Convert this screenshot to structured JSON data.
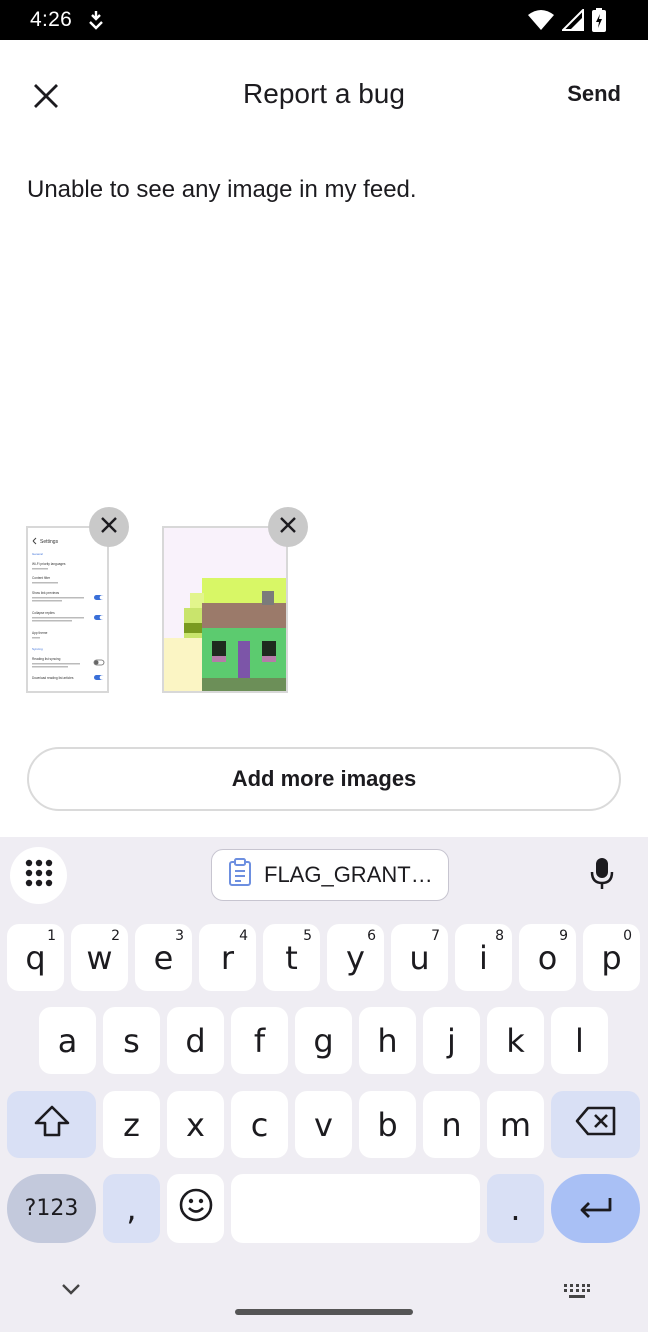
{
  "status_bar": {
    "time": "4:26"
  },
  "app_bar": {
    "title": "Report a bug",
    "send_label": "Send"
  },
  "report": {
    "text": "Unable to see any image in my feed."
  },
  "thumbnail_settings": {
    "header": "Settings",
    "section_general": "General",
    "items": [
      "Wi-Fi priority languages",
      "Content filter",
      "Show link previews",
      "Collapse replies",
      "App theme"
    ],
    "section_syncing": "Syncing",
    "items2": [
      "Reading list syncing",
      "Download reading list articles"
    ]
  },
  "add_images_button": "Add more images",
  "keyboard": {
    "clipboard_chip": "FLAG_GRANT…",
    "row1": [
      "q",
      "w",
      "e",
      "r",
      "t",
      "y",
      "u",
      "i",
      "o",
      "p"
    ],
    "row1_sup": [
      "1",
      "2",
      "3",
      "4",
      "5",
      "6",
      "7",
      "8",
      "9",
      "0"
    ],
    "row2": [
      "a",
      "s",
      "d",
      "f",
      "g",
      "h",
      "j",
      "k",
      "l"
    ],
    "row3": [
      "z",
      "x",
      "c",
      "v",
      "b",
      "n",
      "m"
    ],
    "symbols": "?123",
    "comma": ",",
    "period": "."
  },
  "colors": {
    "accent": "#a9c0f5",
    "keyboard_bg": "#efedf3",
    "modifier": "#d9e0f5"
  }
}
